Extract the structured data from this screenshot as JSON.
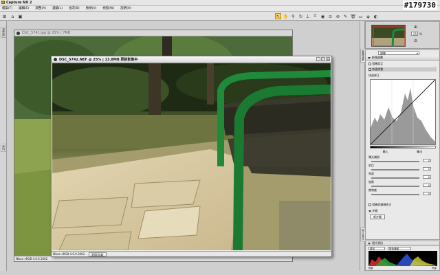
{
  "app": {
    "title": "Capture NX 2"
  },
  "menu": [
    "檔案(F)",
    "編輯(E)",
    "調整(A)",
    "濾鏡(L)",
    "批次(B)",
    "檢視(V)",
    "視窗(W)",
    "說明(H)"
  ],
  "watermark": "#179730",
  "left_tabs": [
    "瀏覽器",
    "資料"
  ],
  "right_tabs": [
    "編輯清單",
    "相片資訊"
  ],
  "windows": {
    "back": {
      "title": "DSC_5741.jpg @ 25% | 7MB",
      "status": "Nikon sRGB 4.0.0.3002"
    },
    "front": {
      "title": "DSC_5742.NEF @ 25% | 13.8MB 更新影像中",
      "status": "Nikon sRGB 4.0.0.3002",
      "compare_button": "對照/比較"
    }
  },
  "navigator": {
    "zoom": "25",
    "unit": "%"
  },
  "edit_list": {
    "dropdown": "調整",
    "section1": "影像調整",
    "item_base": "相機設定",
    "item_quick": "快速修整",
    "curve_label": "快速修正",
    "input_label": "輸入",
    "output_label": "輸出",
    "sliders": [
      {
        "label": "曝光補償",
        "value": "0"
      },
      {
        "label": "對比",
        "value": "0"
      },
      {
        "label": "亮部",
        "value": "0"
      },
      {
        "label": "陰影",
        "value": "0"
      },
      {
        "label": "飽和度",
        "value": "0"
      }
    ],
    "item_camera": "相機與鏡頭修正",
    "step_label": "步驟",
    "add_step": "新步驟"
  },
  "photo_info": {
    "header": "相片資訊",
    "dropdown1": "增加",
    "dropdown2": "藍色通道",
    "left_label": "陰影",
    "right_label": "亮部"
  },
  "colors": {
    "accent": "#f5d36b",
    "bench_green": "#1f8a3a"
  }
}
